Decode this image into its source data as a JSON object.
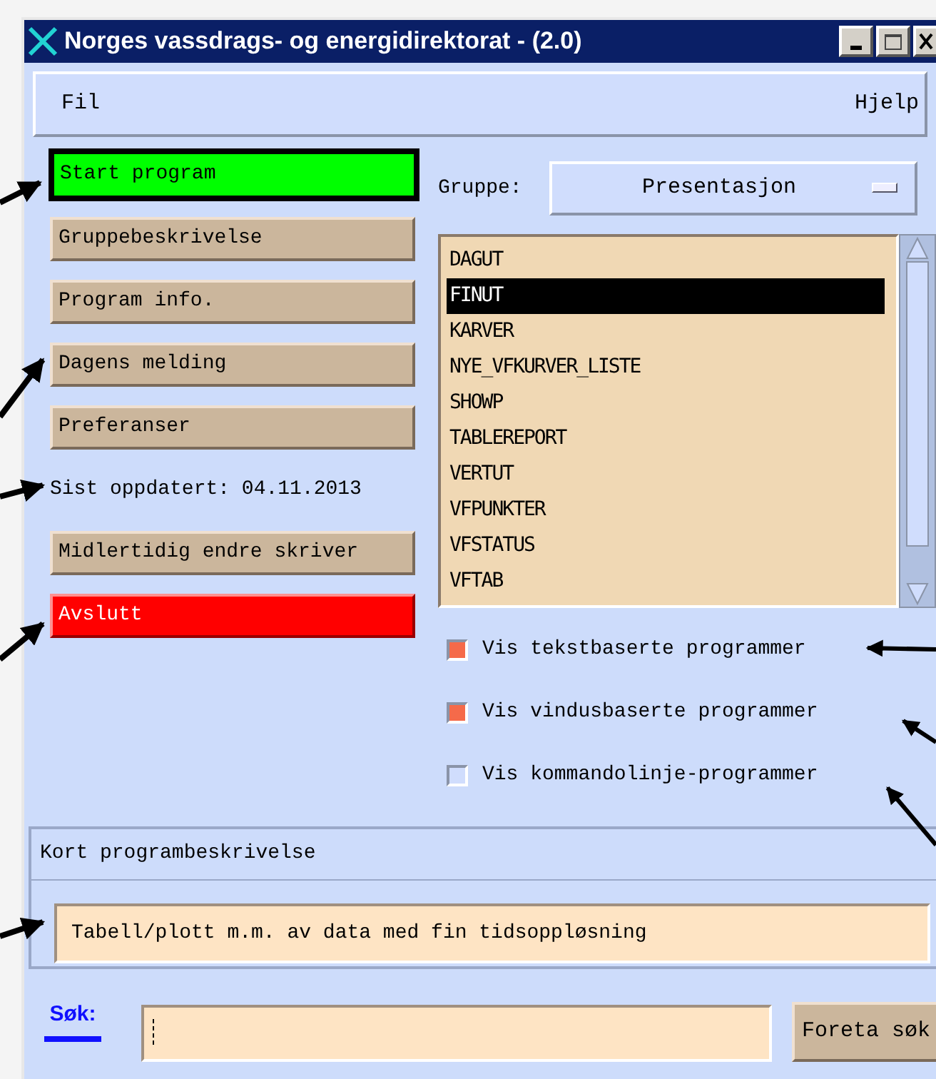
{
  "window": {
    "title": "Norges vassdrags- og energidirektorat -  (2.0)"
  },
  "menu": [
    {
      "label": "Fil"
    },
    {
      "label": "Hjelp"
    }
  ],
  "actions": [
    {
      "kind": "primary",
      "label": "Start program"
    },
    {
      "kind": "button",
      "label": "Gruppebeskrivelse"
    },
    {
      "kind": "button",
      "label": "Program info."
    },
    {
      "kind": "button",
      "label": "Dagens melding"
    },
    {
      "kind": "button",
      "label": "Preferanser"
    },
    {
      "kind": "text",
      "label": "Sist oppdatert: 04.11.2013"
    },
    {
      "kind": "button",
      "label": "Midlertidig endre skriver"
    },
    {
      "kind": "danger",
      "label": "Avslutt"
    }
  ],
  "group": {
    "label": "Gruppe:",
    "value": "Presentasjon"
  },
  "programs": [
    {
      "name": "DAGUT",
      "selected": false
    },
    {
      "name": "FINUT",
      "selected": true
    },
    {
      "name": "KARVER",
      "selected": false
    },
    {
      "name": "NYE_VFKURVER_LISTE",
      "selected": false
    },
    {
      "name": "SHOWP",
      "selected": false
    },
    {
      "name": "TABLEREPORT",
      "selected": false
    },
    {
      "name": "VERTUT",
      "selected": false
    },
    {
      "name": "VFPUNKTER",
      "selected": false
    },
    {
      "name": "VFSTATUS",
      "selected": false
    },
    {
      "name": "VFTAB",
      "selected": false
    }
  ],
  "filters": [
    {
      "label": "Vis tekstbaserte programmer",
      "checked": true
    },
    {
      "label": "Vis vindusbaserte programmer",
      "checked": true
    },
    {
      "label": "Vis kommandolinje-programmer",
      "checked": false
    }
  ],
  "description": {
    "heading": "Kort programbeskrivelse",
    "text": "Tabell/plott m.m. av data med fin tidsoppløsning"
  },
  "search": {
    "label": "Søk:",
    "button": "Foreta søk"
  }
}
